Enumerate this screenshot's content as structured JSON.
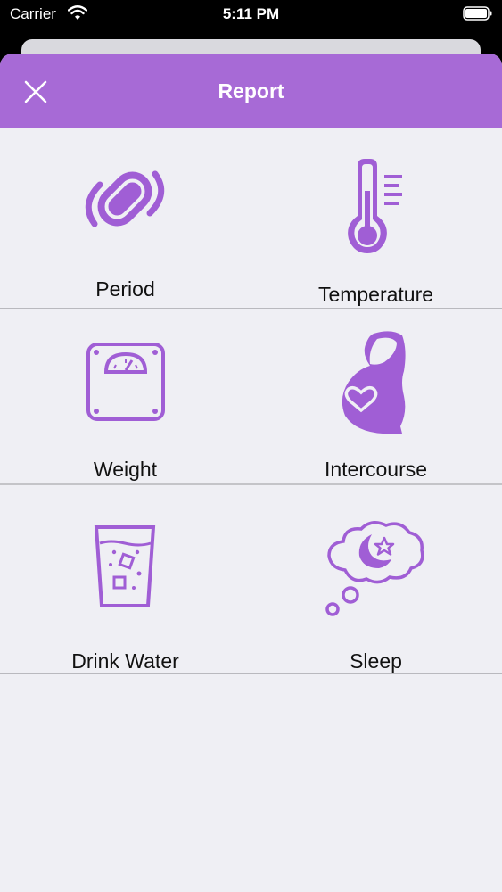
{
  "status_bar": {
    "carrier": "Carrier",
    "time": "5:11 PM"
  },
  "header": {
    "title": "Report"
  },
  "accent_color": "#a76ad6",
  "items": [
    {
      "label": "Period",
      "icon": "sanitary-pad-icon"
    },
    {
      "label": "Temperature",
      "icon": "thermometer-icon"
    },
    {
      "label": "Weight",
      "icon": "weight-scale-icon"
    },
    {
      "label": "Intercourse",
      "icon": "pregnant-heart-icon"
    },
    {
      "label": "Drink Water",
      "icon": "water-glass-icon"
    },
    {
      "label": "Sleep",
      "icon": "moon-cloud-icon"
    }
  ]
}
